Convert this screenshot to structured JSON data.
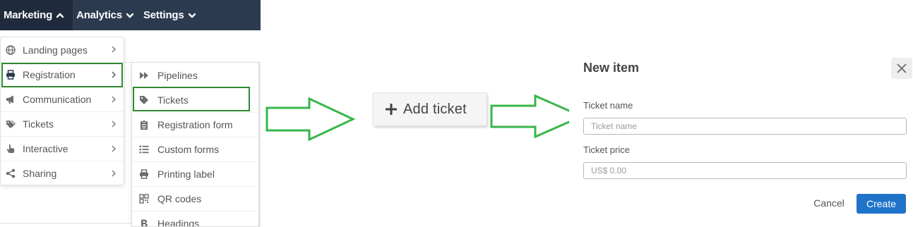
{
  "nav": {
    "items": [
      {
        "label": "Marketing",
        "icon": "chevron-up-icon"
      },
      {
        "label": "Analytics",
        "icon": "chevron-down-icon"
      },
      {
        "label": "Settings",
        "icon": "chevron-down-icon"
      }
    ]
  },
  "marketing_menu": {
    "items": [
      {
        "label": "Landing pages",
        "icon": "globe-icon"
      },
      {
        "label": "Registration",
        "icon": "printer-icon"
      },
      {
        "label": "Communication",
        "icon": "megaphone-icon"
      },
      {
        "label": "Tickets",
        "icon": "tags-icon"
      },
      {
        "label": "Interactive",
        "icon": "pointer-hand-icon"
      },
      {
        "label": "Sharing",
        "icon": "share-icon"
      }
    ]
  },
  "registration_menu": {
    "items": [
      {
        "label": "Pipelines",
        "icon": "fast-forward-icon"
      },
      {
        "label": "Tickets",
        "icon": "tag-icon"
      },
      {
        "label": "Registration form",
        "icon": "clipboard-icon"
      },
      {
        "label": "Custom forms",
        "icon": "list-icon"
      },
      {
        "label": "Printing label",
        "icon": "printer-icon"
      },
      {
        "label": "QR codes",
        "icon": "qrcode-icon"
      },
      {
        "label": "Headings",
        "icon": "bold-icon"
      }
    ]
  },
  "add_ticket": {
    "label": "Add ticket"
  },
  "dialog": {
    "title": "New item",
    "ticket_name_label": "Ticket name",
    "ticket_name_placeholder": "Ticket name",
    "ticket_price_label": "Ticket price",
    "ticket_price_placeholder": "US$ 0.00",
    "cancel_label": "Cancel",
    "create_label": "Create"
  },
  "colors": {
    "nav_bg": "#2b3a4e",
    "highlight": "#2f8a2f",
    "arrow": "#37b64a",
    "primary": "#1f73c8"
  }
}
